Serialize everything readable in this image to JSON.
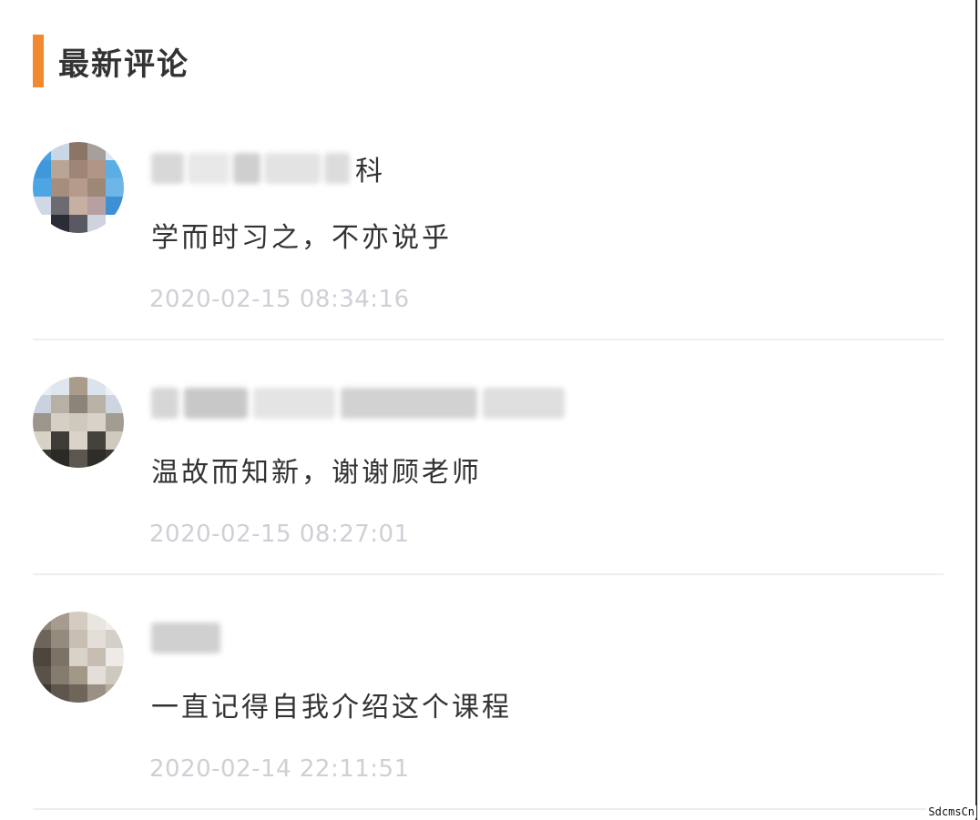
{
  "section": {
    "title": "最新评论",
    "accent_color": "#f2892e"
  },
  "comments": [
    {
      "username_visible": "科",
      "username_blurred": true,
      "text": "学而时习之，不亦说乎",
      "timestamp": "2020-02-15 08:34:16",
      "avatar": "pixelated-avatar"
    },
    {
      "username_visible": "",
      "username_blurred": true,
      "text": "温故而知新，谢谢顾老师",
      "timestamp": "2020-02-15 08:27:01",
      "avatar": "pixelated-avatar"
    },
    {
      "username_visible": "",
      "username_blurred": true,
      "text": "一直记得自我介绍这个课程",
      "timestamp": "2020-02-14 22:11:51",
      "avatar": "pixelated-avatar"
    }
  ],
  "watermark": "SdcmsCn"
}
